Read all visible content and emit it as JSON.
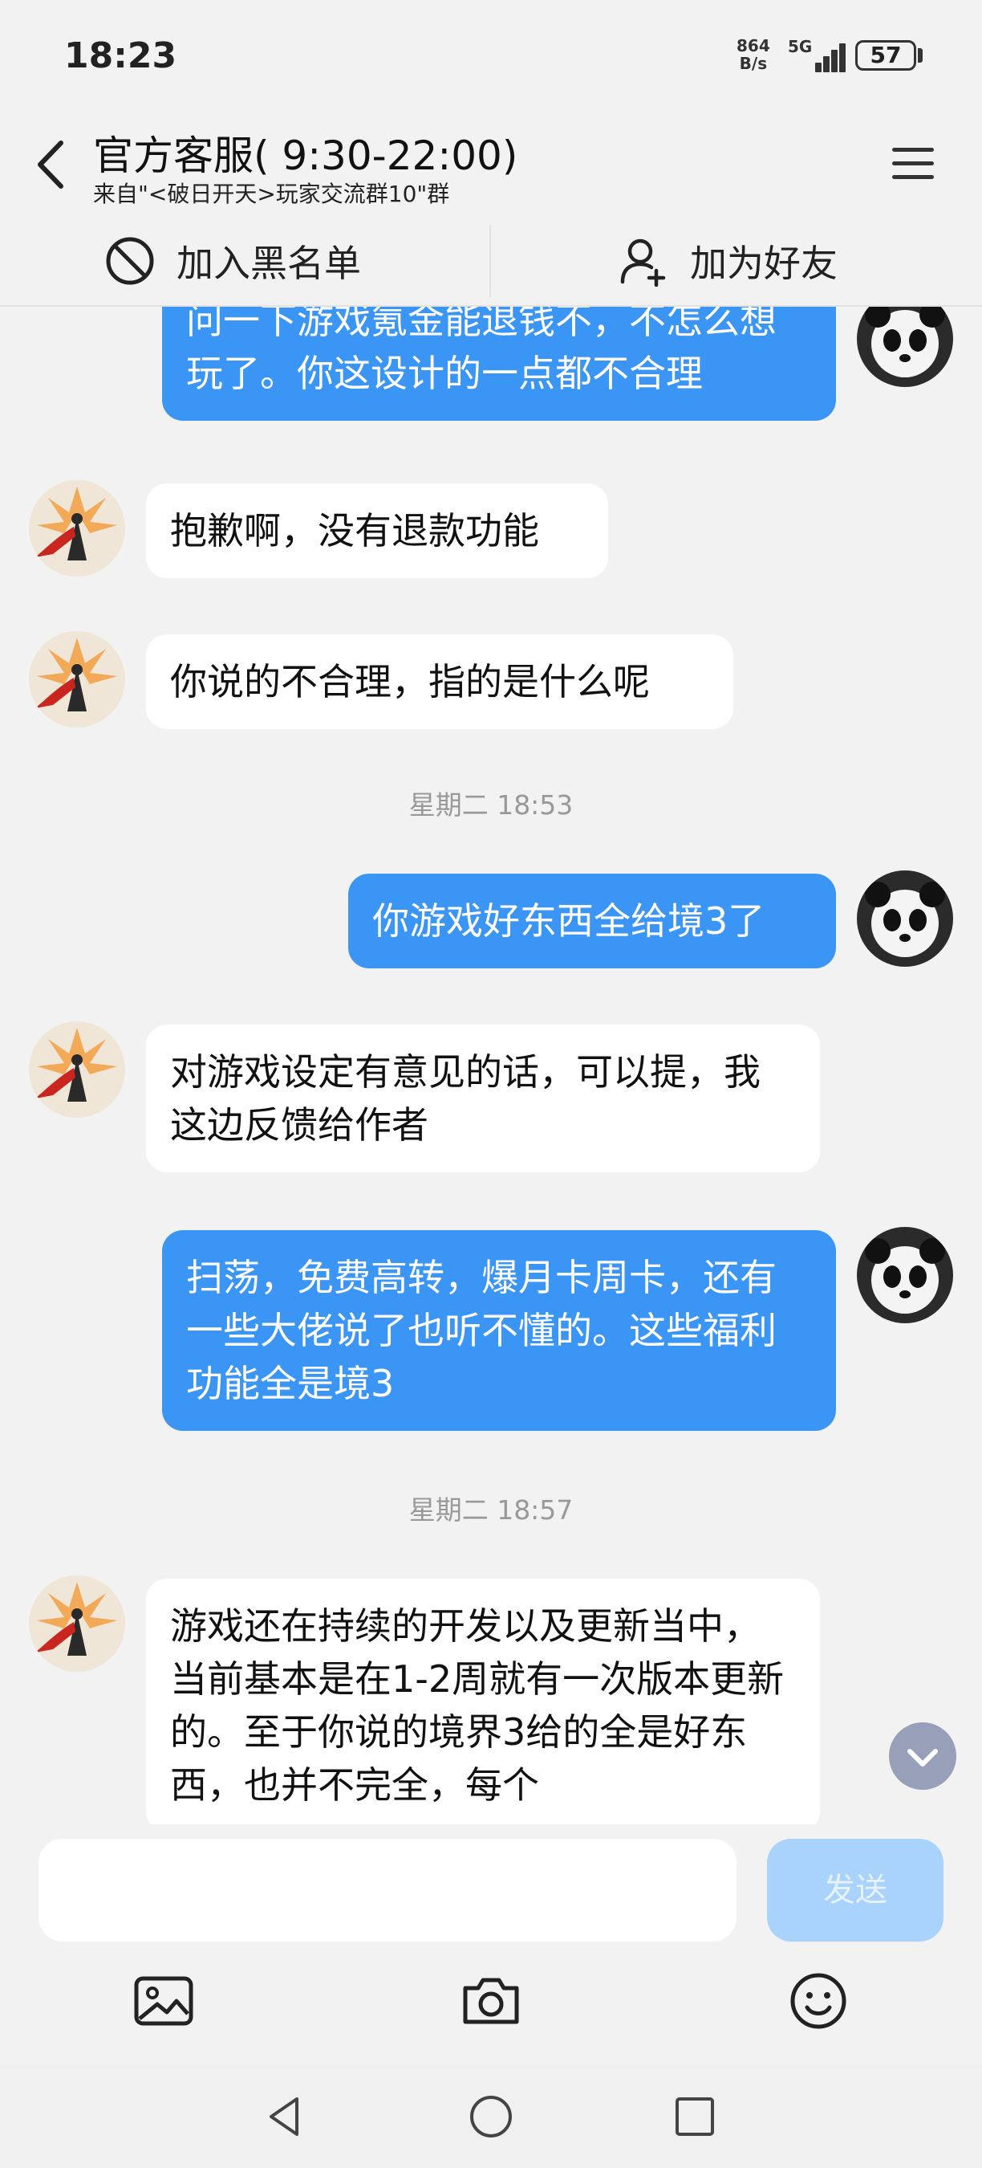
{
  "status_bar": {
    "time": "18:23",
    "net_speed_value": "864",
    "net_speed_unit": "B/s",
    "network_type": "5G",
    "battery": "57"
  },
  "header": {
    "title": "官方客服( 9:30-22:00)",
    "subtitle": "来自\"<破日开天>玩家交流群10\"群",
    "back_icon": "chevron-left-icon",
    "menu_icon": "hamburger-menu-icon"
  },
  "actions": {
    "block_label": "加入黑名单",
    "add_friend_label": "加为好友"
  },
  "messages": [
    {
      "from": "me",
      "text": "问一下游戏氪金能退钱不，不怎么想玩了。你这设计的一点都不合理"
    },
    {
      "from": "agent",
      "text": "抱歉啊，没有退款功能"
    },
    {
      "from": "agent",
      "text": "你说的不合理，指的是什么呢"
    },
    {
      "type": "timestamp",
      "text": "星期二 18:53"
    },
    {
      "from": "me",
      "text": "你游戏好东西全给境3了"
    },
    {
      "from": "agent",
      "text": "对游戏设定有意见的话，可以提，我这边反馈给作者"
    },
    {
      "from": "me",
      "text": "扫荡，免费高转，爆月卡周卡，还有一些大佬说了也听不懂的。这些福利功能全是境3"
    },
    {
      "type": "timestamp",
      "text": "星期二 18:57"
    },
    {
      "from": "agent",
      "text": "游戏还在持续的开发以及更新当中，当前基本是在1-2周就有一次版本更新的。至于你说的境界3给的全是好东西，也并不完全，每个"
    }
  ],
  "input": {
    "value": "",
    "send_label": "发送"
  },
  "toolbar_icons": [
    "image-icon",
    "camera-icon",
    "emoji-icon"
  ],
  "colors": {
    "background": "#f2f2f2",
    "outgoing_bubble": "#3b95f5",
    "incoming_bubble": "#ffffff",
    "send_button": "#a9d3fb",
    "timestamp_text": "#999999"
  }
}
